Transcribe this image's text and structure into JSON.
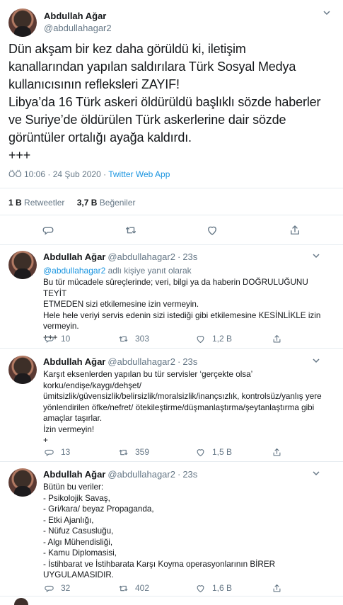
{
  "main": {
    "name": "Abdullah Ağar",
    "handle": "@abdullahagar2",
    "lines": [
      "Dün akşam bir kez daha görüldü ki, iletişim",
      "kanallarından yapılan saldırılara Türk Sosyal Medya",
      "kullanıcısının refleksleri ZAYIF!",
      "Libya’da 16 Türk askeri öldürüldü başlıklı sözde haberler",
      "ve Suriye’de öldürülen Türk askerlerine dair sözde",
      "görüntüler ortalığı ayağa kaldırdı.",
      "+++"
    ],
    "time": "ÖÖ 10:06 · 24 Şub 2020 · ",
    "source": "Twitter Web App",
    "retweets": "1 B",
    "retweets_label": "Retweetler",
    "likes": "3,7 B",
    "likes_label": "Beğeniler"
  },
  "icons": {
    "reply": "reply-icon",
    "retweet": "retweet-icon",
    "like": "heart-icon",
    "share": "share-icon",
    "caret": "chevron-down-icon"
  },
  "colors": {
    "accent": "#1b95e0",
    "muted": "#657786",
    "divider": "#e6ecf0"
  },
  "replies": [
    {
      "name": "Abdullah Ağar",
      "handle": "@abdullahagar2",
      "time": "23s",
      "reply_to": "@abdullahagar2",
      "reply_suffix": " adlı kişiye yanıt olarak",
      "lines": [
        "Bu tür mücadele süreçlerinde; veri, bilgi ya da haberin DOĞRULUĞUNU TEYİT",
        "ETMEDEN sizi etkilemesine izin vermeyin.",
        "Hele hele veriyi servis edenin sizi istediği gibi etkilemesine KESİNLİKLE izin",
        "vermeyin.",
        "+++"
      ],
      "reply_count": "10",
      "retweet_count": "303",
      "like_count": "1,2 B"
    },
    {
      "name": "Abdullah Ağar",
      "handle": "@abdullahagar2",
      "time": "23s",
      "lines": [
        "Karşıt eksenlerden yapılan bu tür servisler ‘gerçekte olsa’",
        "korku/endişe/kaygı/dehşet/",
        "ümitsizlik/güvensizlik/belirsizlik/moralsizlik/inançsızlık, kontrolsüz/yanlış yere",
        "yönlendirilen öfke/nefret/ ötekileştirme/düşmanlaştırma/şeytanlaştırma gibi",
        "amaçlar taşırlar.",
        "İzin vermeyin!",
        "+"
      ],
      "reply_count": "13",
      "retweet_count": "359",
      "like_count": "1,5 B"
    },
    {
      "name": "Abdullah Ağar",
      "handle": "@abdullahagar2",
      "time": "23s",
      "lines": [
        "Bütün bu veriler:",
        "- Psikolojik Savaş,",
        "- Gri/kara/ beyaz Propaganda,",
        "- Etki Ajanlığı,",
        "- Nüfuz Casusluğu,",
        "- Algı Mühendisliği,",
        "- Kamu Diplomasisi,",
        "- İstihbarat ve İstihbarata Karşı Koyma operasyonlarının BİRER",
        "UYGULAMASIDIR."
      ],
      "reply_count": "32",
      "retweet_count": "402",
      "like_count": "1,6 B"
    }
  ]
}
